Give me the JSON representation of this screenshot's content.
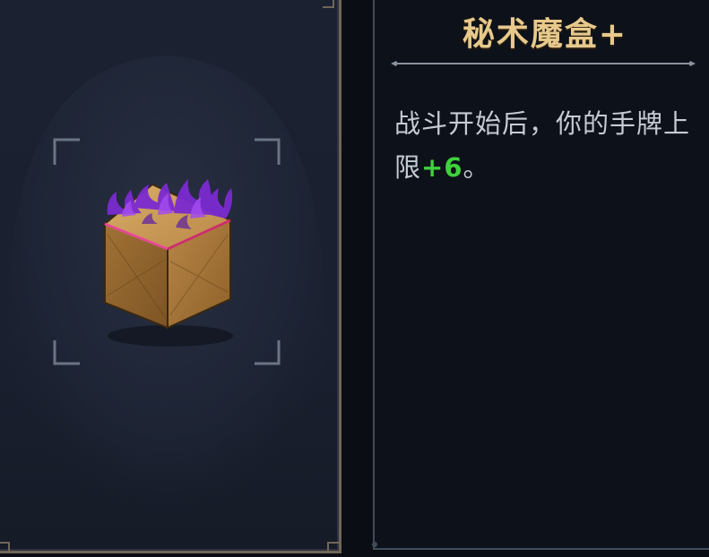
{
  "relic": {
    "name": "秘术魔盒+",
    "description_prefix": "战斗开始后，你的手牌上限",
    "description_value": "+6",
    "description_suffix": "。"
  },
  "colors": {
    "title": "#e7c98b",
    "description_text": "#c5cbd4",
    "highlight_value": "#3fd13d",
    "panel_bg": "#1a2030",
    "frame_border": "#6f6658",
    "reticle": "#6b7484",
    "flame": "#8a2bd6"
  },
  "icons": {
    "relic_image": "arcane-box-icon",
    "reticle": "target-reticle-corners",
    "divider": "ornamental-divider-line"
  }
}
